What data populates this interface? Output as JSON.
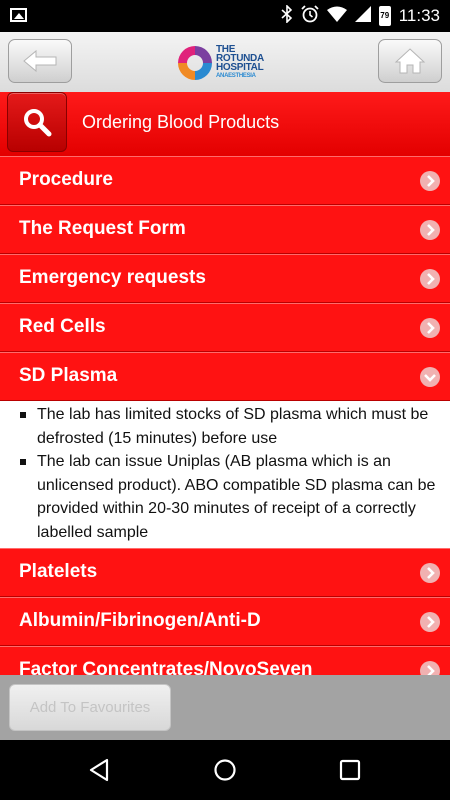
{
  "status_bar": {
    "time": "11:33",
    "battery_level": "79",
    "icons": [
      "image-icon",
      "bluetooth-icon",
      "alarm-icon",
      "wifi-icon",
      "signal-icon",
      "battery-icon"
    ]
  },
  "header": {
    "back_icon": "back-arrow-icon",
    "home_icon": "home-icon",
    "logo": {
      "line1": "THE",
      "line2": "ROTUNDA",
      "line3": "HOSPITAL",
      "line4": "ANAESTHESIA"
    }
  },
  "titlebar": {
    "title": "Ordering Blood Products",
    "search_icon": "search-icon"
  },
  "sections": [
    {
      "label": "Procedure",
      "expanded": false
    },
    {
      "label": "The Request Form",
      "expanded": false
    },
    {
      "label": "Emergency requests",
      "expanded": false
    },
    {
      "label": "Red Cells",
      "expanded": false
    },
    {
      "label": "SD Plasma",
      "expanded": true,
      "bullets": [
        "The lab has limited stocks of SD plasma which must be defrosted (15 minutes) before use",
        "The lab can issue Uniplas (AB plasma which is an unlicensed product). ABO compatible SD plasma can be provided within 20-30 minutes of receipt of a correctly labelled sample"
      ]
    },
    {
      "label": "Platelets",
      "expanded": false
    },
    {
      "label": "Albumin/Fibrinogen/Anti-D",
      "expanded": false
    },
    {
      "label": "Factor Concentrates/NovoSeven",
      "expanded": false
    }
  ],
  "footer": {
    "favourites_label": "Add To Favourites"
  },
  "colors": {
    "accent_red": "#ff1212",
    "header_gray": "#e6e6e6",
    "footer_gray": "#a3a3a3"
  }
}
